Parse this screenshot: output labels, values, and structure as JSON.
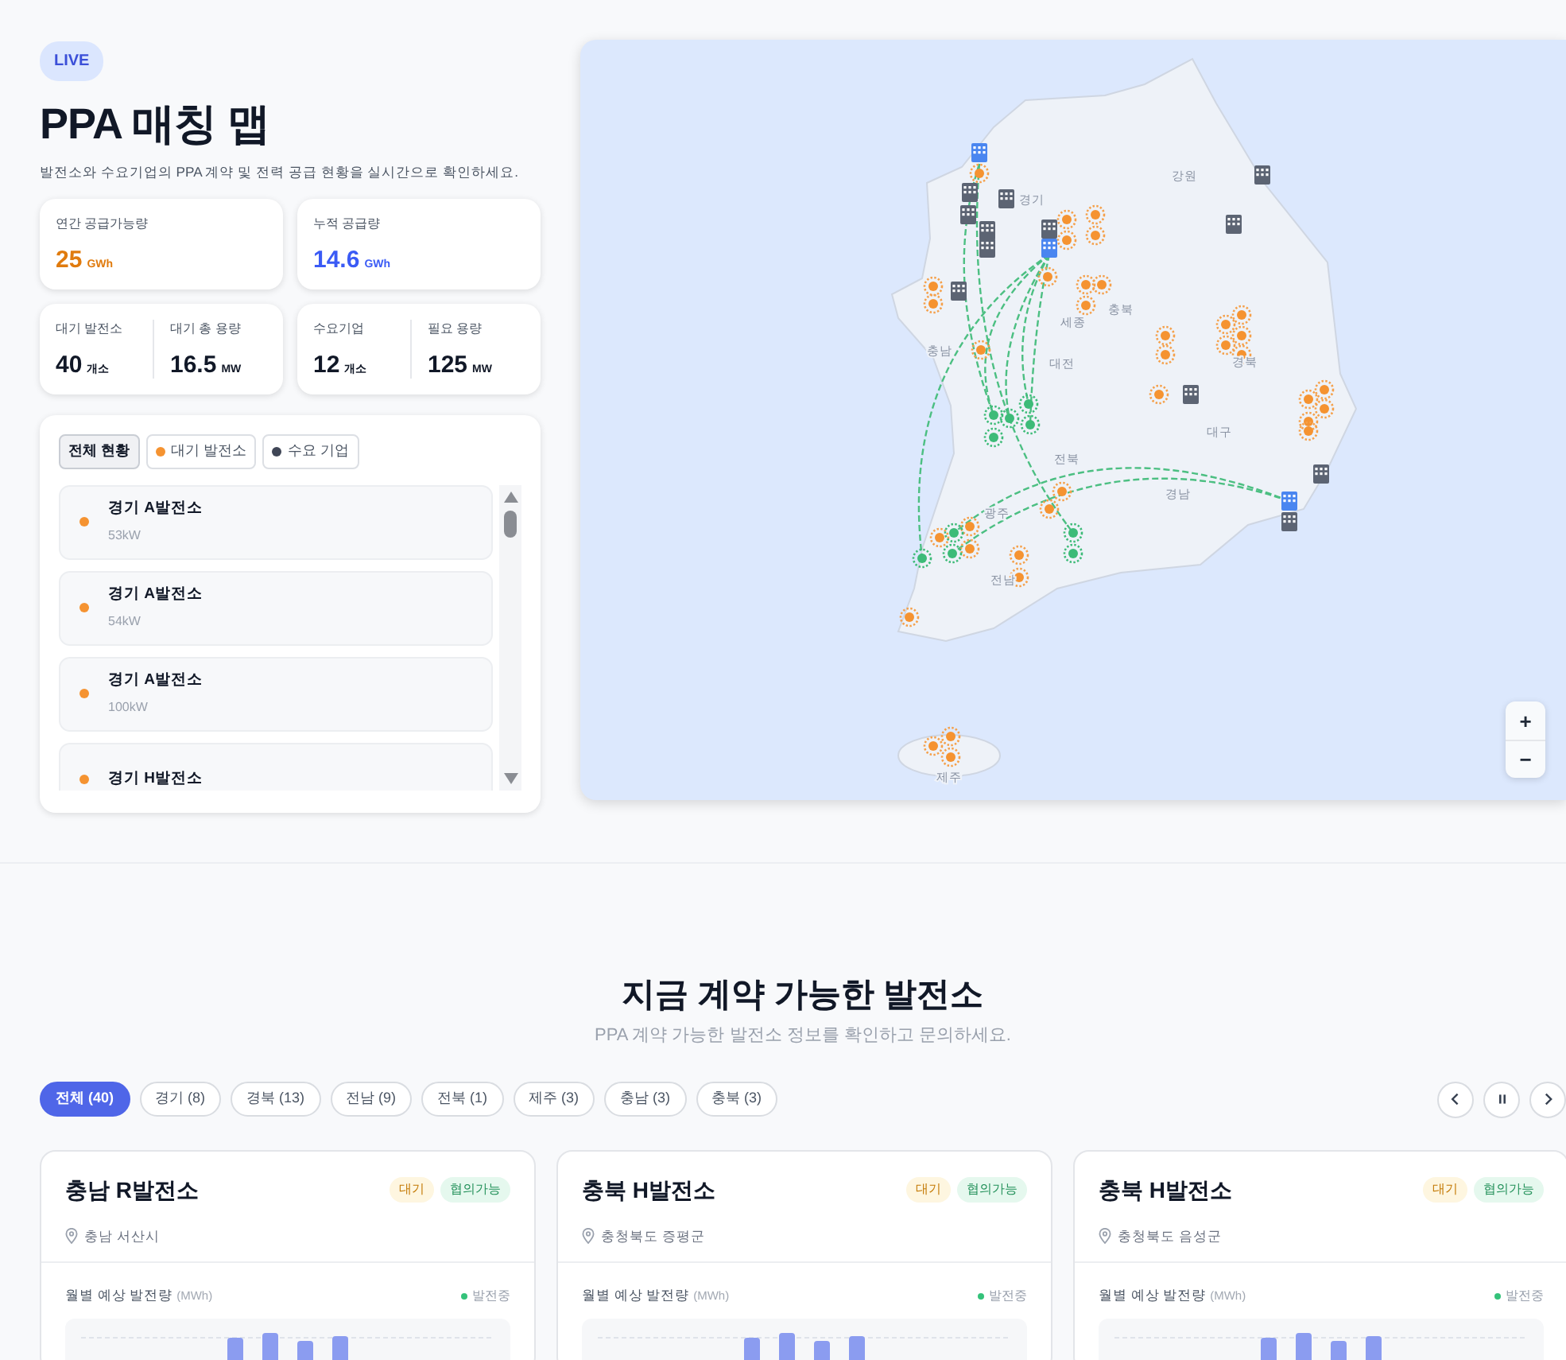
{
  "header": {
    "badge": "LIVE",
    "title": "PPA 매칭 맵",
    "subtitle": "발전소와 수요기업의 PPA 계약 및 전력 공급 현황을 실시간으로 확인하세요."
  },
  "stat_cards": [
    {
      "metrics": [
        {
          "label": "연간 공급가능량",
          "value": "25",
          "unit": "GWh",
          "color": "#e07b0e"
        }
      ]
    },
    {
      "metrics": [
        {
          "label": "누적 공급량",
          "value": "14.6",
          "unit": "GWh",
          "color": "#3b5bf5"
        }
      ]
    },
    {
      "metrics": [
        {
          "label": "대기 발전소",
          "value": "40",
          "unit": "개소"
        },
        {
          "label": "대기 총 용량",
          "value": "16.5",
          "unit": "MW"
        }
      ]
    },
    {
      "metrics": [
        {
          "label": "수요기업",
          "value": "12",
          "unit": "개소"
        },
        {
          "label": "필요 용량",
          "value": "125",
          "unit": "MW"
        }
      ]
    }
  ],
  "filters": [
    {
      "label": "전체 현황",
      "selected": true
    },
    {
      "label": "대기 발전소",
      "selected": false,
      "color": "#f59331"
    },
    {
      "label": "수요 기업",
      "selected": false,
      "color": "#3f4656"
    }
  ],
  "plants": [
    {
      "name": "경기 A발전소",
      "capacity": "53kW"
    },
    {
      "name": "경기 A발전소",
      "capacity": "54kW"
    },
    {
      "name": "경기 A발전소",
      "capacity": "100kW"
    },
    {
      "name": "경기 H발전소"
    }
  ],
  "map": {
    "region_labels": [
      "강원",
      "경기",
      "충북",
      "세종",
      "충남",
      "대전",
      "경북",
      "전북",
      "대구",
      "경남",
      "광주",
      "전남",
      "제주"
    ],
    "zoom_in": "+",
    "zoom_out": "−"
  },
  "section": {
    "title": "지금 계약 가능한 발전소",
    "subtitle": "PPA 계약 가능한 발전소 정보를 확인하고 문의하세요.",
    "region_filters": [
      {
        "label": "전체 (40)",
        "selected": true
      },
      {
        "label": "경기 (8)",
        "selected": false
      },
      {
        "label": "경북 (13)",
        "selected": false
      },
      {
        "label": "전남 (9)",
        "selected": false
      },
      {
        "label": "전북 (1)",
        "selected": false
      },
      {
        "label": "제주 (3)",
        "selected": false
      },
      {
        "label": "충남 (3)",
        "selected": false
      },
      {
        "label": "충북 (3)",
        "selected": false
      }
    ],
    "cards": [
      {
        "name": "충남 R발전소",
        "tags": [
          {
            "label": "대기",
            "kind": "waiting"
          },
          {
            "label": "협의가능",
            "kind": "negotiable"
          }
        ],
        "location": "충남 서산시",
        "chart_label": "월별 예상 발전량",
        "chart_unit": "(MWh)",
        "status": "발전중"
      },
      {
        "name": "충북 H발전소",
        "tags": [
          {
            "label": "대기",
            "kind": "waiting"
          },
          {
            "label": "협의가능",
            "kind": "negotiable"
          }
        ],
        "location": "충청북도 증평군",
        "chart_label": "월별 예상 발전량",
        "chart_unit": "(MWh)",
        "status": "발전중"
      },
      {
        "name": "충북 H발전소",
        "tags": [
          {
            "label": "대기",
            "kind": "waiting"
          },
          {
            "label": "협의가능",
            "kind": "negotiable"
          }
        ],
        "location": "충청북도 음성군",
        "chart_label": "월별 예상 발전량",
        "chart_unit": "(MWh)",
        "status": "발전중"
      }
    ]
  }
}
